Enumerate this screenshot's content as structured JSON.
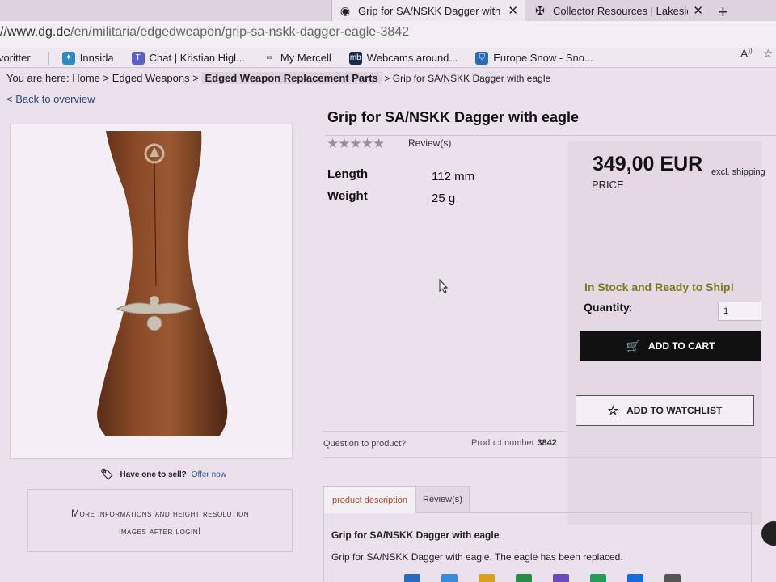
{
  "browser": {
    "tabs": [
      {
        "label": "Grip for SA/NSKK Dagger with eag",
        "active": true
      },
      {
        "label": "Collector Resources | Lakesidetrad",
        "active": false
      }
    ],
    "url_prefix": "//www.dg.de",
    "url_path": "/en/militaria/edgedweapon/grip-sa-nskk-dagger-eagle-3842",
    "bookmarks": [
      {
        "label": "voritter",
        "icon": "favorites-icon"
      },
      {
        "label": "Innsida",
        "icon": "innsida-icon"
      },
      {
        "label": "Chat | Kristian Higl...",
        "icon": "teams-icon"
      },
      {
        "label": "My Mercell",
        "icon": "mercell-icon"
      },
      {
        "label": "Webcams around...",
        "icon": "mb-icon",
        "icon_text": "mb"
      },
      {
        "label": "Europe Snow - Sno...",
        "icon": "shield-icon"
      }
    ]
  },
  "breadcrumb": {
    "prefix": "You are here:",
    "items": [
      "Home",
      "Edged Weapons",
      "Edged Weapon Replacement Parts",
      "Grip for SA/NSKK Dagger with eagle"
    ]
  },
  "back_link": "< Back to overview",
  "product": {
    "title": "Grip for SA/NSKK Dagger with eagle",
    "reviews_label": "Review(s)",
    "rating": 0,
    "specs": [
      {
        "label": "Length",
        "value": "112 mm"
      },
      {
        "label": "Weight",
        "value": "25 g"
      }
    ],
    "price": "349,00 EUR",
    "price_note": "excl. shipping",
    "price_label": "PRICE",
    "stock": "In Stock and Ready to Ship!",
    "quantity_label": "Quantity",
    "quantity_suffix": ":",
    "quantity_value": "1",
    "add_to_cart": "ADD TO CART",
    "add_to_watchlist": "ADD TO WATCHLIST",
    "question_link": "Question to product?",
    "product_number_label": "Product number",
    "product_number": "3842"
  },
  "sell": {
    "text": "Have one to sell?",
    "link": "Offer now"
  },
  "more_info": {
    "line1": "More informations and height resolution",
    "line2": "images after login!"
  },
  "tabs": [
    {
      "label": "product description",
      "active": true
    },
    {
      "label": "Review(s)",
      "active": false
    }
  ],
  "description": {
    "title": "Grip for SA/NSKK Dagger with eagle",
    "text": "Grip for SA/NSKK Dagger with eagle. The eagle has been replaced."
  },
  "colors": {
    "stock": "#7c7a1e",
    "cart_button": "#111111",
    "active_tab": "#b24a2a",
    "link": "#2a4a7a"
  }
}
